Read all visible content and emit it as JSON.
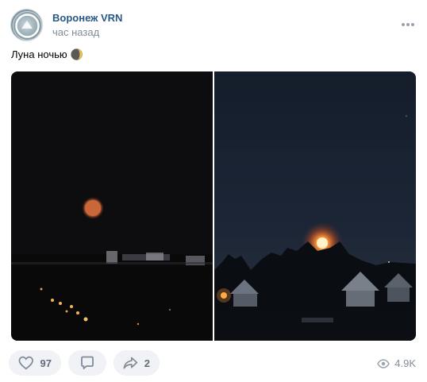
{
  "post": {
    "author": "Воронеж VRN",
    "time": "час назад",
    "text": "Луна ночью",
    "emoji_icon": "moon-emoji-icon"
  },
  "photos": [
    {
      "alt": "moon-over-city-night-photo"
    },
    {
      "alt": "moonrise-over-houses-photo"
    }
  ],
  "actions": {
    "likes": "97",
    "comments": "",
    "shares": "2"
  },
  "stats": {
    "views": "4.9K"
  },
  "colors": {
    "author_link": "#2a5885",
    "muted": "#818c99",
    "button_bg": "#f0f2f5"
  }
}
